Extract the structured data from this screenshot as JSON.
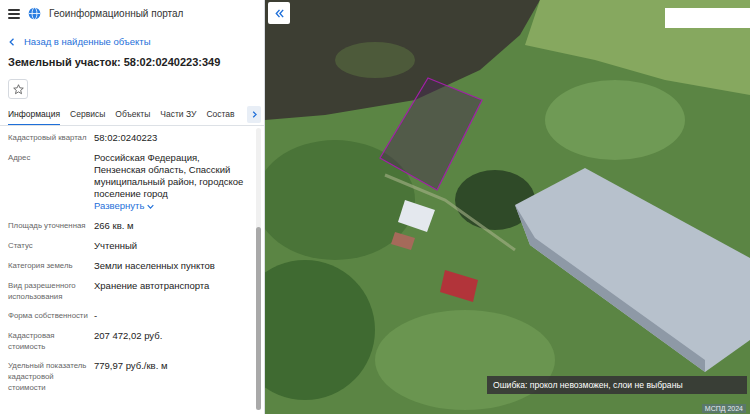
{
  "header": {
    "title": "Геоинформационный портал"
  },
  "back_link": "Назад в найденные объекты",
  "object_title": "Земельный участок: 58:02:0240223:349",
  "favorite": false,
  "tabs": [
    {
      "label": "Информация",
      "selected": true
    },
    {
      "label": "Сервисы",
      "selected": false
    },
    {
      "label": "Объекты",
      "selected": false
    },
    {
      "label": "Части ЗУ",
      "selected": false
    },
    {
      "label": "Состав",
      "selected": false
    }
  ],
  "fields": [
    {
      "kind": "text",
      "label": "Кадастровый квартал",
      "value": "58:02:0240223"
    },
    {
      "kind": "expandable",
      "label": "Адрес",
      "value": "Российская Федерация, Пензенская область, Спасский муниципальный район, городское поселение город",
      "link": "Развернуть"
    },
    {
      "kind": "text",
      "label": "Площадь уточненная",
      "value": "266 кв. м"
    },
    {
      "kind": "text",
      "label": "Статус",
      "value": "Учтенный"
    },
    {
      "kind": "text",
      "label": "Категория земель",
      "value": "Земли населенных пунктов"
    },
    {
      "kind": "text",
      "label": "Вид разрешенного использования",
      "value": "Хранение автотранспорта"
    },
    {
      "kind": "text",
      "label": "Форма собственности",
      "value": "-"
    },
    {
      "kind": "text",
      "label": "Кадастровая стоимость",
      "value": "207 472,02 руб."
    },
    {
      "kind": "text",
      "label": "Удельный показатель кадастровой стоимости",
      "value": "779,97 руб./кв. м"
    }
  ],
  "scrollbar": {
    "level": 0.65
  },
  "map": {
    "toast": "Ошибка: прокол невозможен, слои не выбраны",
    "watermark": "МСПД 2024"
  }
}
